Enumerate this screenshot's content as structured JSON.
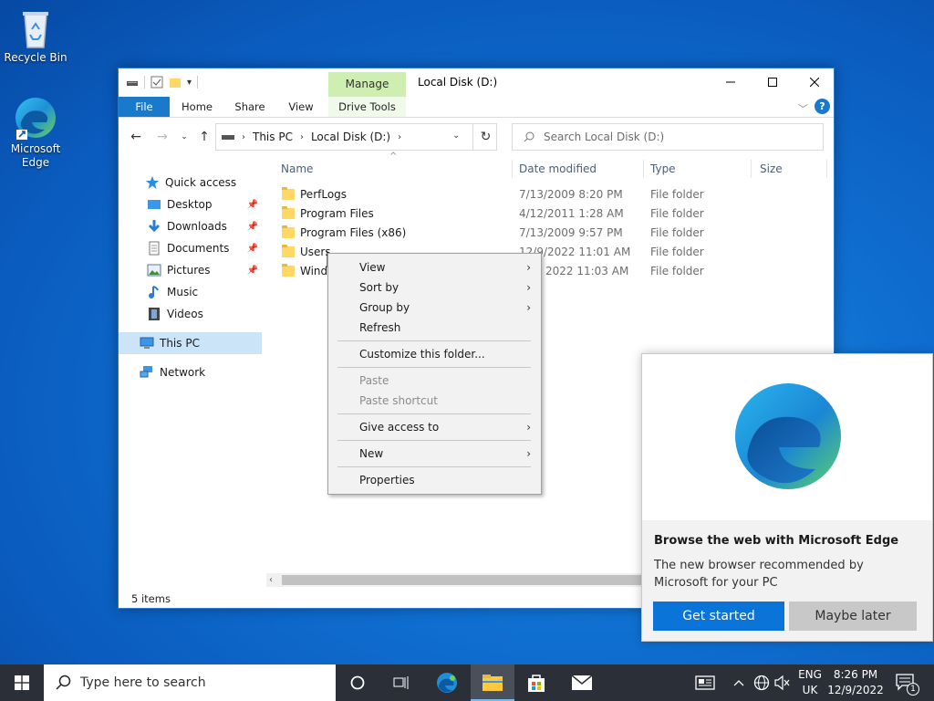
{
  "desktop": {
    "recycle_bin_label": "Recycle Bin",
    "edge_label": "Microsoft Edge"
  },
  "explorer": {
    "title": "Local Disk (D:)",
    "manage_label": "Manage",
    "tabs": [
      "File",
      "Home",
      "Share",
      "View",
      "Drive Tools"
    ],
    "breadcrumb": [
      "This PC",
      "Local Disk (D:)"
    ],
    "search_placeholder": "Search Local Disk (D:)",
    "nav": {
      "quick_access": "Quick access",
      "desktop": "Desktop",
      "downloads": "Downloads",
      "documents": "Documents",
      "pictures": "Pictures",
      "music": "Music",
      "videos": "Videos",
      "this_pc": "This PC",
      "network": "Network"
    },
    "columns": [
      "Name",
      "Date modified",
      "Type",
      "Size"
    ],
    "files": [
      {
        "name": "PerfLogs",
        "date": "7/13/2009 8:20 PM",
        "type": "File folder"
      },
      {
        "name": "Program Files",
        "date": "4/12/2011 1:28 AM",
        "type": "File folder"
      },
      {
        "name": "Program Files (x86)",
        "date": "7/13/2009 9:57 PM",
        "type": "File folder"
      },
      {
        "name": "Users",
        "date": "12/9/2022 11:01 AM",
        "type": "File folder"
      },
      {
        "name": "Windo",
        "date": "2022 11:03 AM",
        "type": "File folder"
      }
    ],
    "status": "5 items"
  },
  "context_menu": {
    "view": "View",
    "sort_by": "Sort by",
    "group_by": "Group by",
    "refresh": "Refresh",
    "customize": "Customize this folder...",
    "paste": "Paste",
    "paste_shortcut": "Paste shortcut",
    "give_access": "Give access to",
    "new": "New",
    "properties": "Properties"
  },
  "edge_toast": {
    "title": "Browse the web with Microsoft Edge",
    "body": "The new browser recommended by Microsoft for your PC",
    "primary": "Get started",
    "secondary": "Maybe later"
  },
  "taskbar": {
    "search_placeholder": "Type here to search",
    "lang_1": "ENG",
    "lang_2": "UK",
    "time": "8:26 PM",
    "date": "12/9/2022",
    "notification_count": "1"
  },
  "colors": {
    "accent": "#1979ca",
    "manage_tab": "#cfeeb2",
    "edge_button": "#0a74d9",
    "taskbar": "#2a2f38"
  }
}
